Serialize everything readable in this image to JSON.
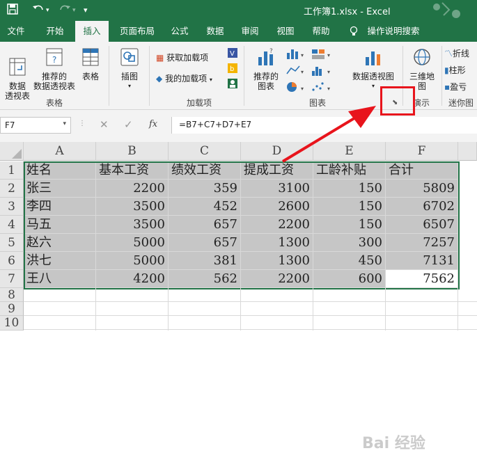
{
  "titlebar": {
    "doc_title": "工作簿1.xlsx  -  Excel"
  },
  "tabs": [
    "文件",
    "开始",
    "插入",
    "页面布局",
    "公式",
    "数据",
    "审阅",
    "视图",
    "帮助",
    "操作说明搜索"
  ],
  "ribbon": {
    "pivot": "数据\n透视表",
    "recommended_pivot": "推荐的\n数据透视表",
    "table": "表格",
    "group_tables": "表格",
    "illustrations": "插图",
    "get_addins": "获取加载项",
    "my_addins": "我的加载项",
    "group_addins": "加载项",
    "recommended_charts": "推荐的\n图表",
    "pivot_chart": "数据透视图",
    "group_charts": "图表",
    "map3d": "三维地\n图",
    "group_tours": "演示",
    "line_sparkline": "折线",
    "column_sparkline": "柱形",
    "winloss_sparkline": "盈亏",
    "group_sparklines": "迷你图"
  },
  "formula_bar": {
    "name_box": "F7",
    "fx": "fx",
    "formula": "=B7+C7+D7+E7"
  },
  "columns": [
    "A",
    "B",
    "C",
    "D",
    "E",
    "F"
  ],
  "rows": [
    "1",
    "2",
    "3",
    "4",
    "5",
    "6",
    "7",
    "8",
    "9",
    "10"
  ],
  "sheet": {
    "headers": [
      "姓名",
      "基本工资",
      "绩效工资",
      "提成工资",
      "工龄补贴",
      "合计"
    ],
    "data": [
      [
        "张三",
        "2200",
        "359",
        "3100",
        "150",
        "5809"
      ],
      [
        "李四",
        "3500",
        "452",
        "2600",
        "150",
        "6702"
      ],
      [
        "马五",
        "3500",
        "657",
        "2200",
        "150",
        "6507"
      ],
      [
        "赵六",
        "5000",
        "657",
        "1300",
        "300",
        "7257"
      ],
      [
        "洪七",
        "5000",
        "381",
        "1300",
        "450",
        "7131"
      ],
      [
        "王八",
        "4200",
        "562",
        "2200",
        "600",
        "7562"
      ]
    ]
  },
  "watermark": "Bai 经验",
  "colors": {
    "excel_green": "#217346",
    "highlight_red": "#e8141c",
    "selection_gray": "#c6c6c6"
  }
}
